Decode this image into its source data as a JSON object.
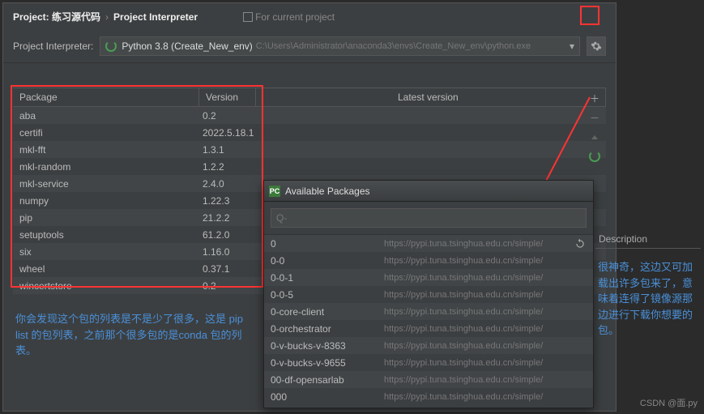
{
  "breadcrumb": {
    "project_label": "Project:",
    "project_name": "练习源代码",
    "page": "Project Interpreter",
    "for_current": "For current project"
  },
  "interpreter": {
    "label": "Project Interpreter:",
    "name": "Python 3.8 (Create_New_env)",
    "path": "C:\\Users\\Administrator\\anaconda3\\envs\\Create_New_env\\python.exe"
  },
  "columns": {
    "package": "Package",
    "version": "Version",
    "latest": "Latest version"
  },
  "packages": [
    {
      "name": "aba",
      "version": "0.2"
    },
    {
      "name": "certifi",
      "version": "2022.5.18.1"
    },
    {
      "name": "mkl-fft",
      "version": "1.3.1"
    },
    {
      "name": "mkl-random",
      "version": "1.2.2"
    },
    {
      "name": "mkl-service",
      "version": "2.4.0"
    },
    {
      "name": "numpy",
      "version": "1.22.3"
    },
    {
      "name": "pip",
      "version": "21.2.2"
    },
    {
      "name": "setuptools",
      "version": "61.2.0"
    },
    {
      "name": "six",
      "version": "1.16.0"
    },
    {
      "name": "wheel",
      "version": "0.37.1"
    },
    {
      "name": "wincertstore",
      "version": "0.2"
    }
  ],
  "available": {
    "title": "Available Packages",
    "search_placeholder": "Q-",
    "description_label": "Description",
    "items": [
      {
        "name": "0",
        "url": "https://pypi.tuna.tsinghua.edu.cn/simple/"
      },
      {
        "name": "0-0",
        "url": "https://pypi.tuna.tsinghua.edu.cn/simple/"
      },
      {
        "name": "0-0-1",
        "url": "https://pypi.tuna.tsinghua.edu.cn/simple/"
      },
      {
        "name": "0-0-5",
        "url": "https://pypi.tuna.tsinghua.edu.cn/simple/"
      },
      {
        "name": "0-core-client",
        "url": "https://pypi.tuna.tsinghua.edu.cn/simple/"
      },
      {
        "name": "0-orchestrator",
        "url": "https://pypi.tuna.tsinghua.edu.cn/simple/"
      },
      {
        "name": "0-v-bucks-v-8363",
        "url": "https://pypi.tuna.tsinghua.edu.cn/simple/"
      },
      {
        "name": "0-v-bucks-v-9655",
        "url": "https://pypi.tuna.tsinghua.edu.cn/simple/"
      },
      {
        "name": "00-df-opensarlab",
        "url": "https://pypi.tuna.tsinghua.edu.cn/simple/"
      },
      {
        "name": "000",
        "url": "https://pypi.tuna.tsinghua.edu.cn/simple/"
      }
    ]
  },
  "annotations": {
    "left": "你会发现这个包的列表是不是少了很多，这是 pip list 的包列表，之前那个很多包的是conda 包的列表。",
    "right": "很神奇，这边又可加载出许多包来了，意味着连得了镜像源那边进行下载你想要的包。"
  },
  "watermark": "CSDN @面.py"
}
